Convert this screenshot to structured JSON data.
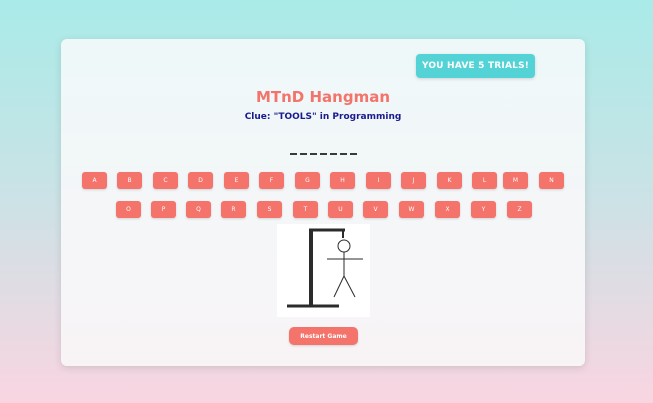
{
  "game": {
    "trials_label": "YOU HAVE 5 TRIALS!",
    "title": "MTnD Hangman",
    "clue": "Clue: \"TOOLS\" in Programming",
    "word_slots": [
      "_",
      "_",
      "_",
      "_",
      "_",
      "_",
      "_"
    ],
    "remaining_trials": 5
  },
  "keyboard": {
    "row1": [
      "A",
      "B",
      "C",
      "D",
      "E",
      "F",
      "G",
      "H",
      "I",
      "J",
      "K",
      "L",
      "M",
      "N"
    ],
    "row2": [
      "O",
      "P",
      "Q",
      "R",
      "S",
      "T",
      "U",
      "V",
      "W",
      "X",
      "Y",
      "Z"
    ]
  },
  "restart_label": "Restart Game",
  "colors": {
    "accent": "#f4736a",
    "trials_badge": "#53d3d6",
    "clue_text": "#1a1a8c"
  }
}
